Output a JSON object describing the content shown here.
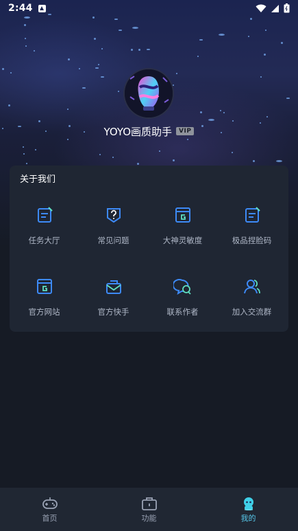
{
  "status_bar": {
    "time": "2:44"
  },
  "profile": {
    "username": "YOYO画质助手",
    "badge": "VIP"
  },
  "section": {
    "title": "关于我们",
    "items": [
      {
        "label": "任务大厅",
        "icon": "task-list-icon"
      },
      {
        "label": "常见问题",
        "icon": "question-shield-icon"
      },
      {
        "label": "大神灵敏度",
        "icon": "g-window-icon"
      },
      {
        "label": "极品捏脸码",
        "icon": "edit-list-icon"
      },
      {
        "label": "官方网站",
        "icon": "g-window-icon"
      },
      {
        "label": "官方快手",
        "icon": "mail-icon"
      },
      {
        "label": "联系作者",
        "icon": "chat-bubbles-icon"
      },
      {
        "label": "加入交流群",
        "icon": "users-icon"
      }
    ]
  },
  "tabbar": {
    "tabs": [
      {
        "label": "首页",
        "icon": "gamepad-icon"
      },
      {
        "label": "功能",
        "icon": "toolbox-icon"
      },
      {
        "label": "我的",
        "icon": "mascot-icon",
        "active": true
      }
    ]
  },
  "colors": {
    "accent": "#3d8af7",
    "active_tab": "#57c7ea"
  }
}
